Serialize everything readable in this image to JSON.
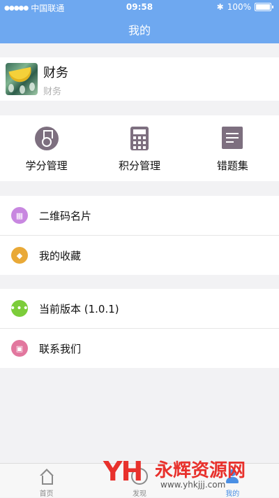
{
  "status_bar": {
    "signal": "●●●●●",
    "carrier": "中国联通",
    "time": "09:58",
    "bluetooth": "✱",
    "battery_percent": "100%"
  },
  "nav": {
    "title": "我的"
  },
  "profile": {
    "name": "财务",
    "subtitle": "财务"
  },
  "grid": [
    {
      "label": "学分管理",
      "icon": "medal-icon"
    },
    {
      "label": "积分管理",
      "icon": "calculator-icon"
    },
    {
      "label": "错题集",
      "icon": "notes-icon"
    }
  ],
  "list_group_1": [
    {
      "label": "二维码名片",
      "icon": "qr-code-icon",
      "color": "#c887e0"
    },
    {
      "label": "我的收藏",
      "icon": "favorites-box-icon",
      "color": "#e9a937"
    }
  ],
  "list_group_2": [
    {
      "label": "当前版本 (1.0.1)",
      "icon": "more-dots-icon",
      "color": "#7ccd3a"
    },
    {
      "label": "联系我们",
      "icon": "contact-grid-icon",
      "color": "#e2779e"
    }
  ],
  "tab_bar": [
    {
      "label": "首页",
      "icon": "home-icon"
    },
    {
      "label": "发现",
      "icon": "discover-icon"
    },
    {
      "label": "我的",
      "icon": "user-icon",
      "active": true
    }
  ],
  "watermark": {
    "logo": "YH",
    "title": "永辉资源网",
    "url": "www.yhkjjj.com"
  },
  "colors": {
    "accent": "#6ea8f0",
    "tab_active": "#4a8fe4",
    "icon_gray": "#7d6f7f"
  }
}
